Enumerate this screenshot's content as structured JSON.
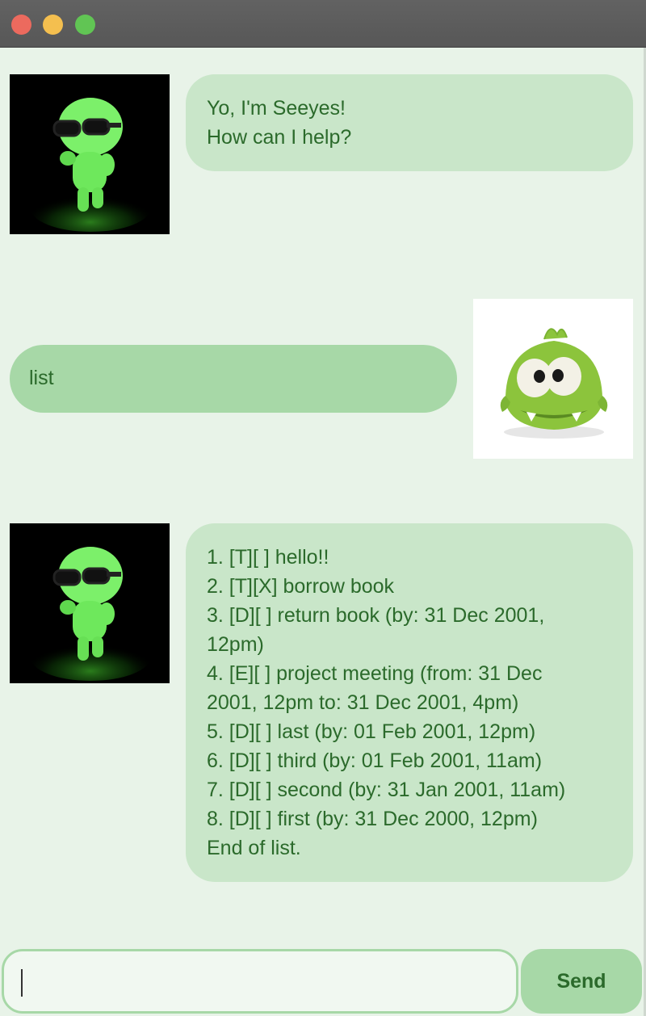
{
  "window": {
    "title": "",
    "controls": [
      "close",
      "minimize",
      "maximize"
    ]
  },
  "messages": [
    {
      "sender": "bot",
      "avatar": "glowing-green-figure-avatar",
      "text": "Yo, I'm Seeyes!\nHow can I help?"
    },
    {
      "sender": "user",
      "avatar": "green-plush-monster-avatar",
      "text": "list"
    },
    {
      "sender": "bot",
      "avatar": "glowing-green-figure-avatar",
      "text": "1. [T][ ] hello!!\n2. [T][X] borrow book\n3. [D][ ] return book (by: 31 Dec 2001,\n12pm)\n4. [E][ ] project meeting (from: 31 Dec\n2001, 12pm to: 31 Dec 2001, 4pm)\n5. [D][ ] last (by: 01 Feb 2001, 12pm)\n6. [D][ ] third (by: 01 Feb 2001, 11am)\n7. [D][ ] second (by: 31 Jan 2001, 11am)\n8. [D][ ] first (by: 31 Dec 2000, 12pm)\nEnd of list."
    }
  ],
  "input": {
    "value": "",
    "placeholder": ""
  },
  "send_button": {
    "label": "Send"
  },
  "colors": {
    "background": "#e8f3e8",
    "bot_bubble": "#c9e6c9",
    "user_bubble": "#a7d8a7",
    "text": "#2b6a2b"
  }
}
